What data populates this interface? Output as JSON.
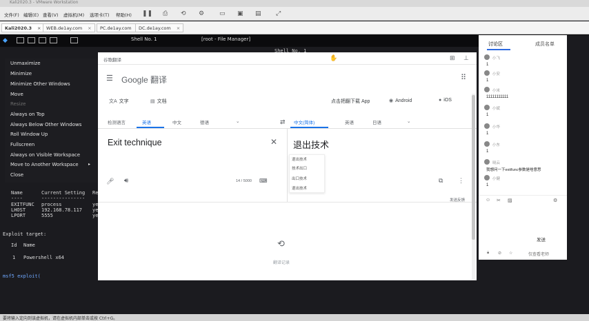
{
  "vm": {
    "title": "Kali2020.3 - VMware Workstation",
    "menus": [
      "文件(F)",
      "编辑(E)",
      "查看(V)",
      "虚拟机(M)",
      "选项卡(T)",
      "帮助(H)"
    ],
    "tabs": [
      "Kali2020.3",
      "WEB.de1ay.com",
      "PC.de1ay.com",
      "DC.de1ay.com"
    ]
  },
  "kali_panel": {
    "tab1": "Shell No. 1",
    "tab2": "[root - File Manager]"
  },
  "terminal": {
    "title": "Shell No. 1",
    "headers": [
      "Name",
      "Current Setting",
      "Re"
    ],
    "sep1": "----",
    "sep2": "---------------",
    "rows": [
      [
        "EXITFUNC",
        "process",
        "ye"
      ],
      [
        "LHOST",
        "192.168.78.117",
        "ye"
      ],
      [
        "LPORT",
        "5555",
        "ye"
      ]
    ],
    "exploit_target_label": "Exploit target:",
    "id_header": "Id",
    "name_header": "Name",
    "target_id": "1",
    "target_name": "Powershell x64",
    "prompt": "msf5 exploit("
  },
  "context_menu": {
    "items": [
      {
        "label": "Unmaximize",
        "dim": false
      },
      {
        "label": "Minimize",
        "dim": false
      },
      {
        "label": "Minimize Other Windows",
        "dim": false
      },
      {
        "label": "Move",
        "dim": false
      },
      {
        "label": "Resize",
        "dim": true
      },
      {
        "label": "Always on Top",
        "dim": false
      },
      {
        "label": "Always Below Other Windows",
        "dim": false
      },
      {
        "label": "Roll Window Up",
        "dim": false
      },
      {
        "label": "Fullscreen",
        "dim": false
      },
      {
        "label": "Always on Visible Workspace",
        "dim": false
      },
      {
        "label": "Move to Another Workspace",
        "dim": false
      },
      {
        "label": "Close",
        "dim": false
      }
    ]
  },
  "translate": {
    "window_title": "谷歌翻译",
    "logo_text": "Google 翻译",
    "modes": {
      "text": "文字",
      "docs": "文档"
    },
    "download_text": "点击把翻下载 App",
    "android": "Android",
    "ios": "iOS",
    "source_langs": [
      "检测语言",
      "英语",
      "中文",
      "德语"
    ],
    "target_langs": [
      "中文(简体)",
      "英语",
      "日语"
    ],
    "source_text": "Exit technique",
    "target_text": "退出技术",
    "suggestions": [
      "退出技术",
      "技术出口",
      "出口技术",
      "退出技术"
    ],
    "char_count": "14 / 5000",
    "history_label": "翻译记录",
    "feedback_label": "发送反馈"
  },
  "chat": {
    "tab_discussion": "讨论区",
    "tab_list": "成员名单",
    "messages": [
      {
        "name": "小飞",
        "text": "1"
      },
      {
        "name": "小安",
        "text": "1"
      },
      {
        "name": "小米",
        "text": "11111111111"
      },
      {
        "name": "小斌",
        "text": "1"
      },
      {
        "name": "小华",
        "text": "1"
      },
      {
        "name": "小东",
        "text": "1"
      },
      {
        "name": "晓云",
        "text": "我想问一下exitfunc参数是啥意思"
      },
      {
        "name": "小健",
        "text": "1"
      }
    ],
    "send_label": "发送",
    "footer": "仅查看老师"
  },
  "status": {
    "hint": "要将输入定向到该虚拟机，请在虚拟机内部单击或按 Ctrl+G。"
  }
}
